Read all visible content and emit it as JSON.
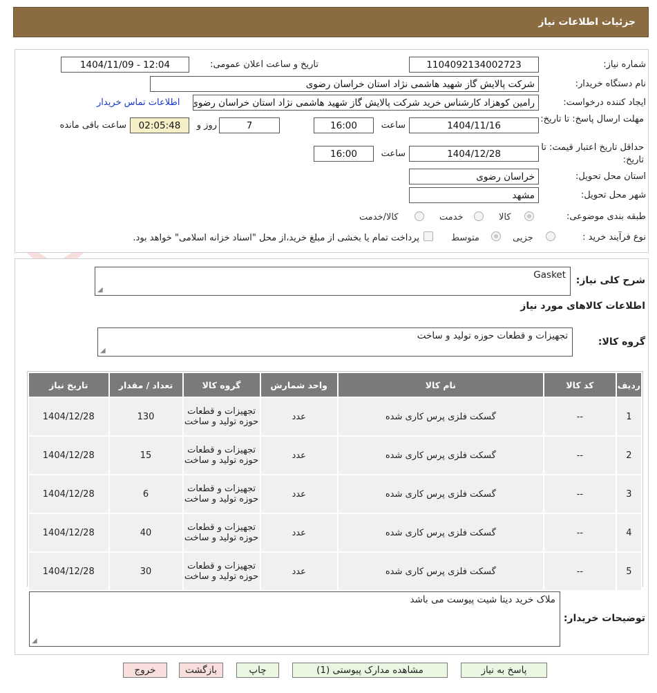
{
  "header": {
    "title": "جزئیات اطلاعات نیاز"
  },
  "fields": {
    "need_number_label": "شماره نیاز:",
    "need_number": "1104092134002723",
    "announce_label": "تاریخ و ساعت اعلان عمومی:",
    "announce_value": "1404/11/09 - 12:04",
    "buyer_label": "نام دستگاه خریدار:",
    "buyer_value": "شرکت پالایش گاز شهید هاشمی نژاد   استان خراسان رضوی",
    "creator_label": "ایجاد کننده درخواست:",
    "creator_value": "رامین کوهزاد کارشناس خرید شرکت پالایش گاز شهید هاشمی نژاد   استان خراسان رضوی",
    "contact_link": "اطلاعات تماس خریدار",
    "deadline_label": "مهلت ارسال پاسخ: تا تاریخ:",
    "deadline_date": "1404/11/16",
    "time_label": "ساعت",
    "deadline_time": "16:00",
    "days_value": "7",
    "days_label": "روز و",
    "remaining_time": "02:05:48",
    "remaining_label": "ساعت باقی مانده",
    "validity_label": "حداقل تاریخ اعتبار قیمت: تا تاریخ:",
    "validity_date": "1404/12/28",
    "validity_time": "16:00",
    "province_label": "استان محل تحویل:",
    "province_value": "خراسان رضوی",
    "city_label": "شهر محل تحویل:",
    "city_value": "مشهد",
    "category_label": "طبقه بندی موضوعی:",
    "category_options": [
      "کالا",
      "خدمت",
      "کالا/خدمت"
    ],
    "category_selected": "کالا",
    "process_label": "نوع فرآیند خرید :",
    "process_options": [
      "جزیی",
      "متوسط"
    ],
    "process_selected": "متوسط",
    "payment_note": "پرداخت تمام یا بخشی از مبلغ خرید،از محل \"اسناد خزانه اسلامی\" خواهد بود."
  },
  "summary": {
    "label": "شرح کلی نیاز:",
    "value": "Gasket"
  },
  "goods_section": {
    "title": "اطلاعات کالاهای مورد نیاز",
    "group_label": "گروه کالا:",
    "group_value": "تجهیزات و قطعات حوزه تولید و ساخت"
  },
  "table": {
    "headers": [
      "ردیف",
      "کد کالا",
      "نام کالا",
      "واحد شمارش",
      "گروه کالا",
      "تعداد / مقدار",
      "تاریخ نیاز"
    ],
    "rows": [
      {
        "row": "1",
        "code": "--",
        "name": "گسکت فلزی پرس کاری شده",
        "unit": "عدد",
        "group": "تجهیزات و قطعات حوزه تولید و ساخت",
        "qty": "130",
        "date": "1404/12/28"
      },
      {
        "row": "2",
        "code": "--",
        "name": "گسکت فلزی پرس کاری شده",
        "unit": "عدد",
        "group": "تجهیزات و قطعات حوزه تولید و ساخت",
        "qty": "15",
        "date": "1404/12/28"
      },
      {
        "row": "3",
        "code": "--",
        "name": "گسکت فلزی پرس کاری شده",
        "unit": "عدد",
        "group": "تجهیزات و قطعات حوزه تولید و ساخت",
        "qty": "6",
        "date": "1404/12/28"
      },
      {
        "row": "4",
        "code": "--",
        "name": "گسکت فلزی پرس کاری شده",
        "unit": "عدد",
        "group": "تجهیزات و قطعات حوزه تولید و ساخت",
        "qty": "40",
        "date": "1404/12/28"
      },
      {
        "row": "5",
        "code": "--",
        "name": "گسکت فلزی پرس کاری شده",
        "unit": "عدد",
        "group": "تجهیزات و قطعات حوزه تولید و ساخت",
        "qty": "30",
        "date": "1404/12/28"
      }
    ]
  },
  "buyer_notes": {
    "label": "توضیحات خریدار:",
    "value": "ملاک خرید دیتا شیت پیوست می باشد"
  },
  "buttons": {
    "reply": "پاسخ به نیاز",
    "attachments": "مشاهده مدارک پیوستی (1)",
    "print": "چاپ",
    "back": "بازگشت",
    "exit": "خروج"
  },
  "watermark": {
    "text": "AriaTender.neT",
    "icon": "shield-lock-icon"
  }
}
